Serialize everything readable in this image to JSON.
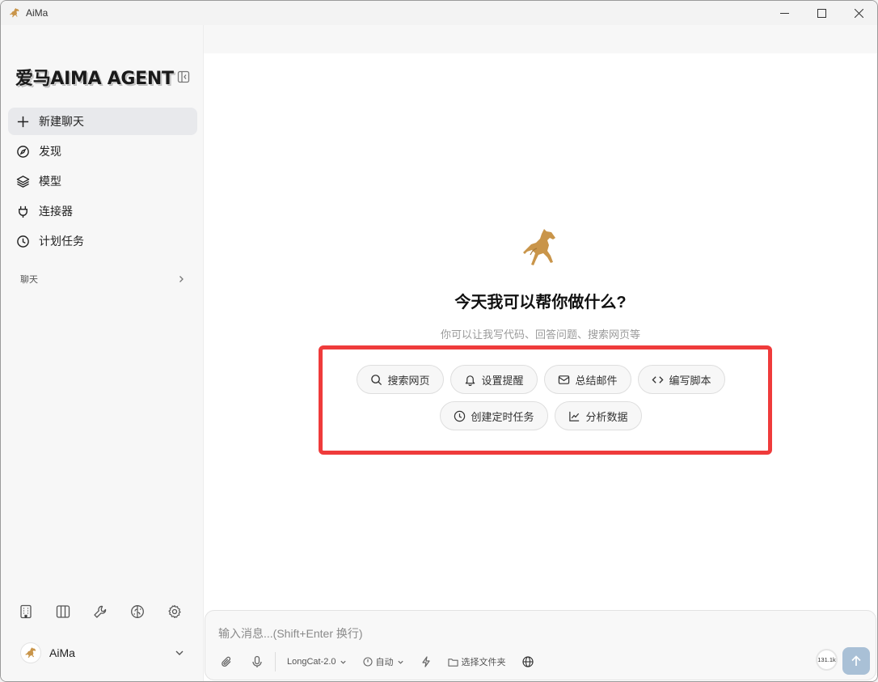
{
  "window": {
    "title": "AiMa"
  },
  "sidebar": {
    "brand": "爱马AIMA AGENT",
    "nav": [
      {
        "label": "新建聊天",
        "icon": "plus-icon",
        "active": true
      },
      {
        "label": "发现",
        "icon": "compass-icon"
      },
      {
        "label": "模型",
        "icon": "layers-icon"
      },
      {
        "label": "连接器",
        "icon": "plug-icon"
      },
      {
        "label": "计划任务",
        "icon": "clock-icon"
      }
    ],
    "section_label": "聊天",
    "user_name": "AiMa"
  },
  "main": {
    "title": "今天我可以帮你做什么?",
    "subtitle": "你可以让我写代码、回答问题、搜索网页等",
    "suggestions": [
      {
        "label": "搜索网页",
        "icon": "search-icon"
      },
      {
        "label": "设置提醒",
        "icon": "bell-icon"
      },
      {
        "label": "总结邮件",
        "icon": "mail-icon"
      },
      {
        "label": "编写脚本",
        "icon": "code-icon"
      },
      {
        "label": "创建定时任务",
        "icon": "clock-icon"
      },
      {
        "label": "分析数据",
        "icon": "chart-icon"
      }
    ]
  },
  "composer": {
    "placeholder": "输入消息...(Shift+Enter 换行)",
    "model": "LongCat-2.0",
    "mode": "自动",
    "folder": "选择文件夹",
    "context_usage": "131.1k"
  },
  "colors": {
    "highlight": "#ef3b3b",
    "send": "#a9c0d6",
    "horse": "#c9954a"
  }
}
